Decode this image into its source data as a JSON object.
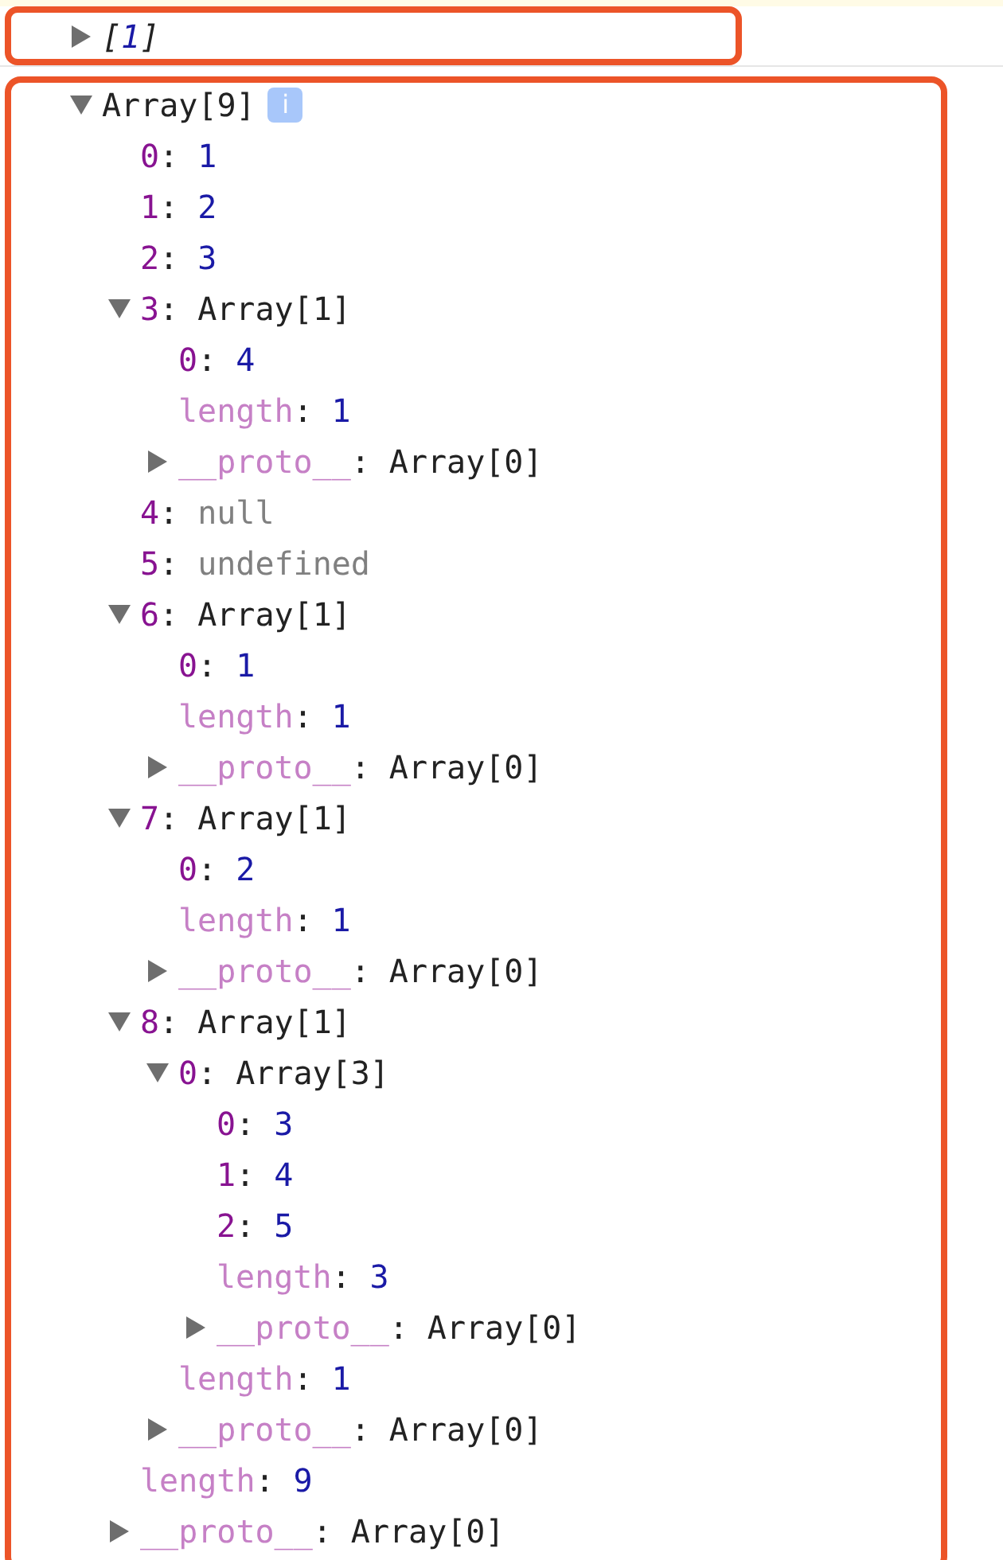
{
  "collapsed_entry": {
    "expanded": false,
    "open": "[",
    "value": "1",
    "close": "]"
  },
  "tree": {
    "label": "Array[9]",
    "expanded": true,
    "info_badge": "i",
    "children": [
      {
        "key": "0",
        "internal": false,
        "separator": ":",
        "value": "1",
        "kind": "number"
      },
      {
        "key": "1",
        "internal": false,
        "separator": ":",
        "value": "2",
        "kind": "number"
      },
      {
        "key": "2",
        "internal": false,
        "separator": ":",
        "value": "3",
        "kind": "number"
      },
      {
        "key": "3",
        "internal": false,
        "separator": ":",
        "value": "Array[1]",
        "kind": "object",
        "expanded": true,
        "children": [
          {
            "key": "0",
            "internal": false,
            "separator": ":",
            "value": "4",
            "kind": "number"
          },
          {
            "key": "length",
            "internal": true,
            "separator": ":",
            "value": "1",
            "kind": "number"
          },
          {
            "key": "__proto__",
            "internal": true,
            "separator": ":",
            "value": "Array[0]",
            "kind": "object",
            "expanded": false
          }
        ]
      },
      {
        "key": "4",
        "internal": false,
        "separator": ":",
        "value": "null",
        "kind": "empty"
      },
      {
        "key": "5",
        "internal": false,
        "separator": ":",
        "value": "undefined",
        "kind": "empty"
      },
      {
        "key": "6",
        "internal": false,
        "separator": ":",
        "value": "Array[1]",
        "kind": "object",
        "expanded": true,
        "children": [
          {
            "key": "0",
            "internal": false,
            "separator": ":",
            "value": "1",
            "kind": "number"
          },
          {
            "key": "length",
            "internal": true,
            "separator": ":",
            "value": "1",
            "kind": "number"
          },
          {
            "key": "__proto__",
            "internal": true,
            "separator": ":",
            "value": "Array[0]",
            "kind": "object",
            "expanded": false
          }
        ]
      },
      {
        "key": "7",
        "internal": false,
        "separator": ":",
        "value": "Array[1]",
        "kind": "object",
        "expanded": true,
        "children": [
          {
            "key": "0",
            "internal": false,
            "separator": ":",
            "value": "2",
            "kind": "number"
          },
          {
            "key": "length",
            "internal": true,
            "separator": ":",
            "value": "1",
            "kind": "number"
          },
          {
            "key": "__proto__",
            "internal": true,
            "separator": ":",
            "value": "Array[0]",
            "kind": "object",
            "expanded": false
          }
        ]
      },
      {
        "key": "8",
        "internal": false,
        "separator": ":",
        "value": "Array[1]",
        "kind": "object",
        "expanded": true,
        "children": [
          {
            "key": "0",
            "internal": false,
            "separator": ":",
            "value": "Array[3]",
            "kind": "object",
            "expanded": true,
            "children": [
              {
                "key": "0",
                "internal": false,
                "separator": ":",
                "value": "3",
                "kind": "number"
              },
              {
                "key": "1",
                "internal": false,
                "separator": ":",
                "value": "4",
                "kind": "number"
              },
              {
                "key": "2",
                "internal": false,
                "separator": ":",
                "value": "5",
                "kind": "number"
              },
              {
                "key": "length",
                "internal": true,
                "separator": ":",
                "value": "3",
                "kind": "number"
              },
              {
                "key": "__proto__",
                "internal": true,
                "separator": ":",
                "value": "Array[0]",
                "kind": "object",
                "expanded": false
              }
            ]
          },
          {
            "key": "length",
            "internal": true,
            "separator": ":",
            "value": "1",
            "kind": "number"
          },
          {
            "key": "__proto__",
            "internal": true,
            "separator": ":",
            "value": "Array[0]",
            "kind": "object",
            "expanded": false
          }
        ]
      },
      {
        "key": "length",
        "internal": true,
        "separator": ":",
        "value": "9",
        "kind": "number"
      },
      {
        "key": "__proto__",
        "internal": true,
        "separator": ":",
        "value": "Array[0]",
        "kind": "object",
        "expanded": false
      }
    ]
  }
}
